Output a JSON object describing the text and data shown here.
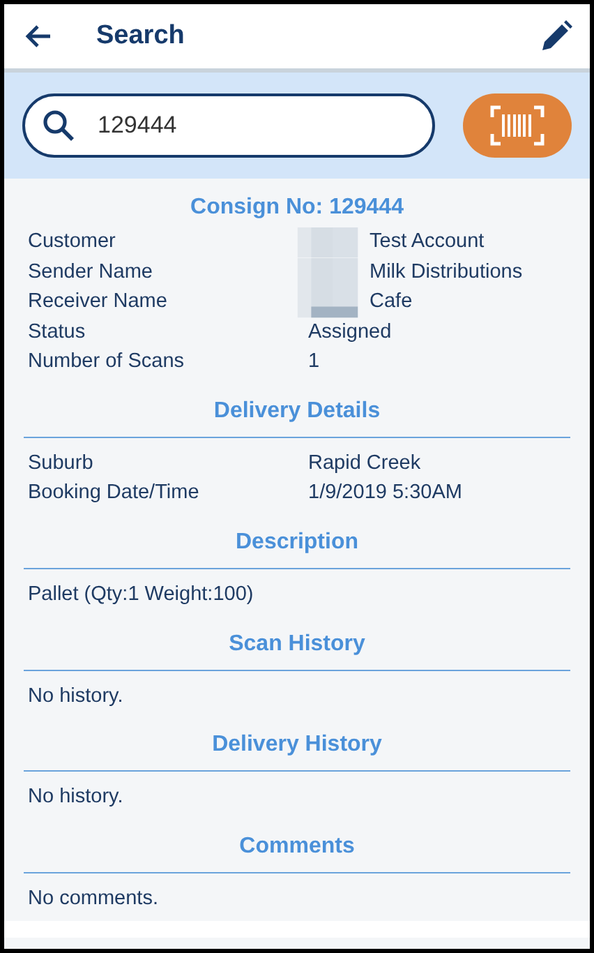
{
  "header": {
    "title": "Search"
  },
  "search": {
    "value": "129444"
  },
  "consignment": {
    "title": "Consign No: 129444",
    "fields": [
      {
        "label": "Customer",
        "value": "Test Account",
        "redacted": true
      },
      {
        "label": "Sender Name",
        "value": "Milk Distributions",
        "redacted": true
      },
      {
        "label": "Receiver Name",
        "value": "Cafe",
        "redacted": true
      },
      {
        "label": "Status",
        "value": "Assigned",
        "redacted": false
      },
      {
        "label": "Number of Scans",
        "value": "1",
        "redacted": false
      }
    ]
  },
  "sections": [
    {
      "title": "Delivery Details",
      "kind": "fields",
      "fields": [
        {
          "label": "Suburb",
          "value": "Rapid Creek"
        },
        {
          "label": "Booking Date/Time",
          "value": "1/9/2019 5:30AM"
        }
      ]
    },
    {
      "title": "Description",
      "kind": "text",
      "text": "Pallet (Qty:1 Weight:100)"
    },
    {
      "title": "Scan History",
      "kind": "text",
      "text": "No history."
    },
    {
      "title": "Delivery History",
      "kind": "text",
      "text": "No history."
    },
    {
      "title": "Comments",
      "kind": "text",
      "text": "No comments."
    }
  ]
}
